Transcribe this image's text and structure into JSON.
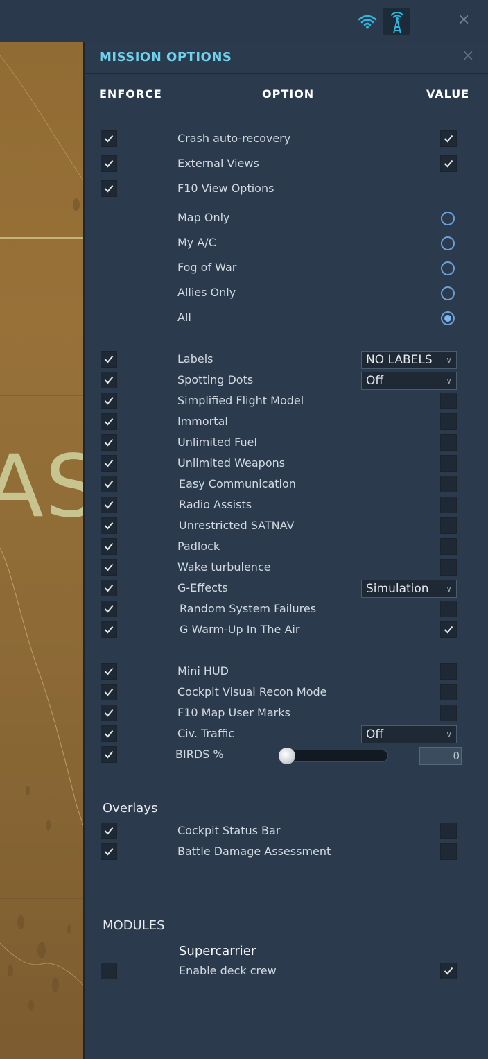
{
  "map": {
    "overlay_text": "AS"
  },
  "topbar": {
    "close_glyph": "×",
    "icons": [
      "wifi-icon",
      "radio-tower-icon"
    ]
  },
  "panel": {
    "title": "MISSION OPTIONS",
    "close_glyph": "×",
    "columns": {
      "enforce": "ENFORCE",
      "option": "OPTION",
      "value": "VALUE"
    }
  },
  "options": {
    "crash": {
      "label": "Crash auto-recovery",
      "enforce": true,
      "value": true
    },
    "external_views": {
      "label": "External Views",
      "enforce": true,
      "value": true
    },
    "f10_view": {
      "label": "F10 View Options",
      "enforce": true
    },
    "f10_choices": [
      {
        "label": "Map Only",
        "selected": false
      },
      {
        "label": "My A/C",
        "selected": false
      },
      {
        "label": "Fog of War",
        "selected": false
      },
      {
        "label": "Allies Only",
        "selected": false
      },
      {
        "label": "All",
        "selected": true
      }
    ],
    "labels": {
      "label": "Labels",
      "enforce": true,
      "value": "NO LABELS"
    },
    "spotting_dots": {
      "label": "Spotting Dots",
      "enforce": true,
      "value": "Off"
    },
    "simplified_flight_model": {
      "label": "Simplified Flight Model",
      "enforce": true,
      "value": false
    },
    "immortal": {
      "label": "Immortal",
      "enforce": true,
      "value": false
    },
    "unlimited_fuel": {
      "label": "Unlimited Fuel",
      "enforce": true,
      "value": false
    },
    "unlimited_weapons": {
      "label": "Unlimited Weapons",
      "enforce": true,
      "value": false
    },
    "easy_communication": {
      "label": "Easy Communication",
      "enforce": true,
      "value": false
    },
    "radio_assists": {
      "label": "Radio Assists",
      "enforce": true,
      "value": false
    },
    "unrestricted_satnav": {
      "label": "Unrestricted SATNAV",
      "enforce": true,
      "value": false
    },
    "padlock": {
      "label": "Padlock",
      "enforce": true,
      "value": false
    },
    "wake_turbulence": {
      "label": "Wake turbulence",
      "enforce": true,
      "value": false
    },
    "g_effects": {
      "label": "G-Effects",
      "enforce": true,
      "value": "Simulation"
    },
    "random_failures": {
      "label": "Random System Failures",
      "enforce": true,
      "value": false
    },
    "g_warmup": {
      "label": "G Warm-Up In The Air",
      "enforce": true,
      "value": true
    },
    "mini_hud": {
      "label": "Mini HUD",
      "enforce": true,
      "value": false
    },
    "visual_recon": {
      "label": "Cockpit Visual Recon Mode",
      "enforce": true,
      "value": false
    },
    "f10_user_marks": {
      "label": "F10 Map User Marks",
      "enforce": true,
      "value": false
    },
    "civ_traffic": {
      "label": "Civ. Traffic",
      "enforce": true,
      "value": "Off"
    },
    "birds": {
      "label": "BIRDS %",
      "enforce": true,
      "value": "0",
      "slider_fraction": 0
    }
  },
  "overlays": {
    "title": "Overlays",
    "status_bar": {
      "label": "Cockpit Status Bar",
      "enforce": true,
      "value": false
    },
    "bda": {
      "label": "Battle Damage Assessment",
      "enforce": true,
      "value": false
    }
  },
  "modules": {
    "title": "MODULES",
    "supercarrier": {
      "title": "Supercarrier",
      "label": "Enable deck crew",
      "enforce": false,
      "value": true
    }
  },
  "colors": {
    "title_accent": "#6fd2ee",
    "panel_bg": "#2b3b4d",
    "radio_accent": "#7cb6f3"
  }
}
